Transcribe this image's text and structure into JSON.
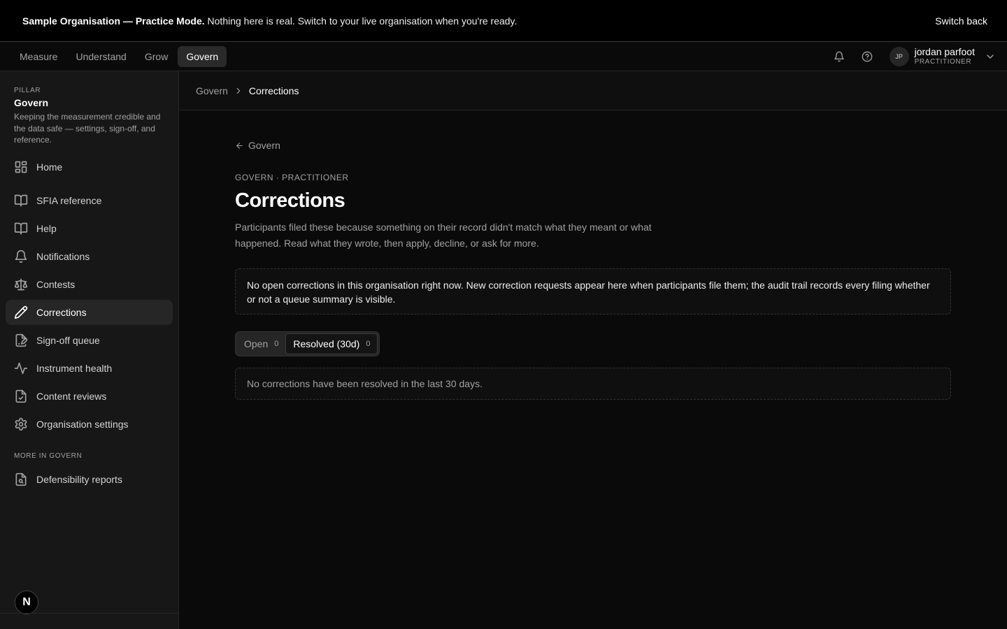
{
  "banner": {
    "strong": "Sample Organisation — Practice Mode.",
    "message": "Nothing here is real. Switch to your live organisation when you're ready.",
    "switch_back": "Switch back"
  },
  "topnav": {
    "tabs": [
      {
        "label": "Measure"
      },
      {
        "label": "Understand"
      },
      {
        "label": "Grow"
      },
      {
        "label": "Govern",
        "active": true
      }
    ],
    "user": {
      "initials": "JP",
      "name": "jordan parfoot",
      "role": "PRACTITIONER"
    }
  },
  "sidebar": {
    "pillar_label": "PILLAR",
    "pillar_name": "Govern",
    "pillar_description": "Keeping the measurement credible and the data safe — settings, sign-off, and reference.",
    "items": [
      {
        "label": "Home",
        "icon": "dashboard-icon"
      },
      {
        "label": "SFIA reference",
        "icon": "book-icon"
      },
      {
        "label": "Help",
        "icon": "book-icon"
      },
      {
        "label": "Notifications",
        "icon": "bell-icon"
      },
      {
        "label": "Contests",
        "icon": "scale-icon"
      },
      {
        "label": "Corrections",
        "icon": "pencil-icon",
        "active": true
      },
      {
        "label": "Sign-off queue",
        "icon": "file-signature-icon"
      },
      {
        "label": "Instrument health",
        "icon": "activity-icon"
      },
      {
        "label": "Content reviews",
        "icon": "file-check-icon"
      },
      {
        "label": "Organisation settings",
        "icon": "gear-icon"
      }
    ],
    "more_label": "MORE IN GOVERN",
    "more_items": [
      {
        "label": "Defensibility reports",
        "icon": "file-search-icon"
      }
    ],
    "logo_letter": "N"
  },
  "breadcrumb": {
    "parent": "Govern",
    "current": "Corrections"
  },
  "page": {
    "back_label": "Govern",
    "eyebrow": "GOVERN · PRACTITIONER",
    "title": "Corrections",
    "lede": "Participants filed these because something on their record didn't match what they meant or what happened. Read what they wrote, then apply, decline, or ask for more.",
    "notice": "No open corrections in this organisation right now. New correction requests appear here when participants file them; the audit trail records every filing whether or not a queue summary is visible.",
    "segments": [
      {
        "label": "Open",
        "count": "0"
      },
      {
        "label": "Resolved (30d)",
        "count": "0",
        "active": true
      }
    ],
    "empty_message": "No corrections have been resolved in the last 30 days."
  }
}
